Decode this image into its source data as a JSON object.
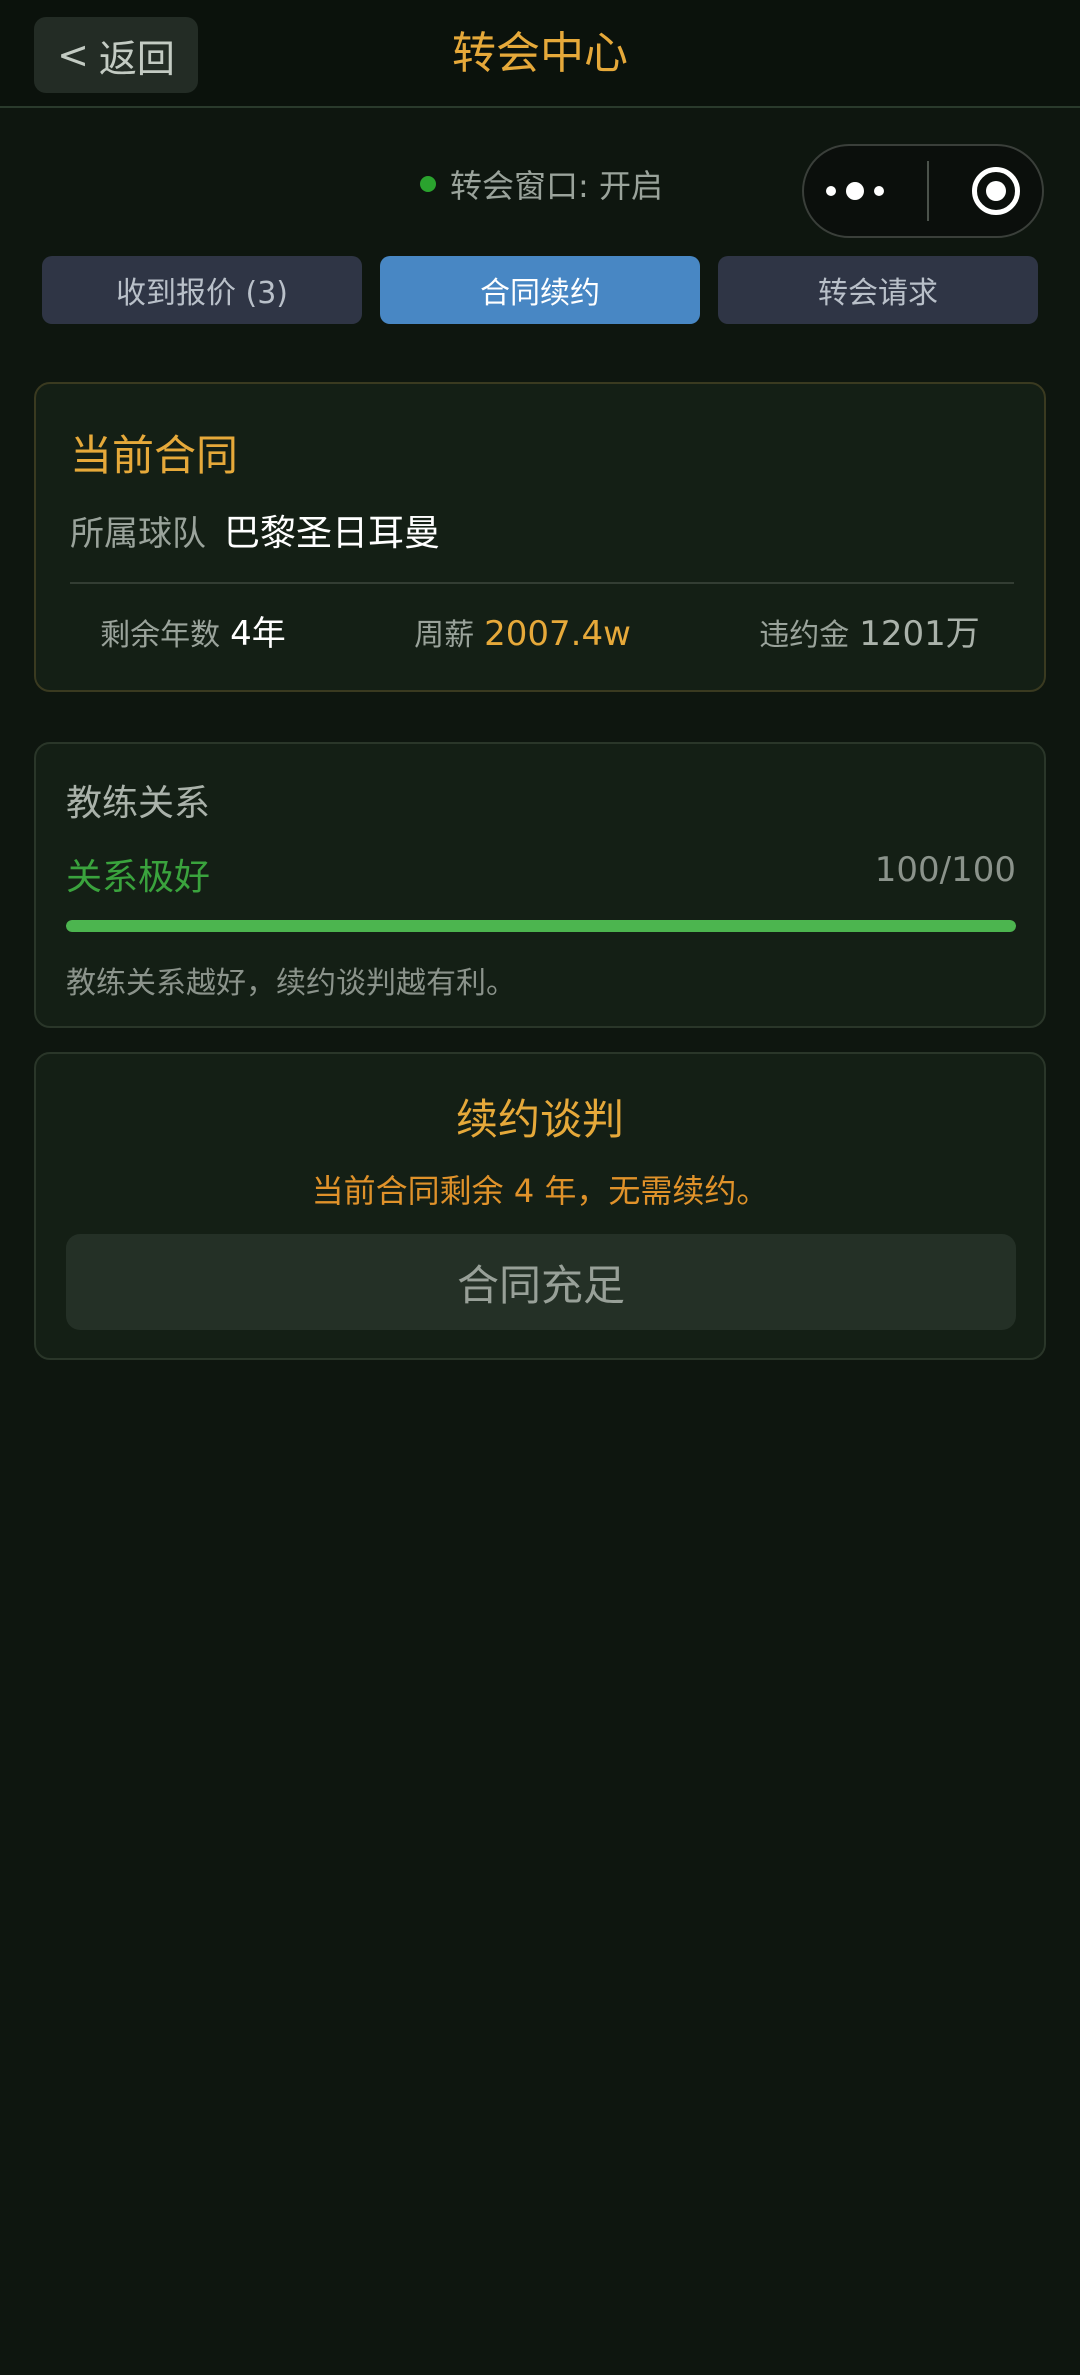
{
  "header": {
    "back_label": "返回",
    "back_chevron": "<",
    "title": "转会中心"
  },
  "status": {
    "text": "转会窗口: 开启",
    "dot_color": "#2aa32e"
  },
  "capsule": {
    "more_icon": "more-dots-icon",
    "close_icon": "target-circle-icon"
  },
  "tabs": [
    {
      "label": "收到报价 (3)",
      "active": false
    },
    {
      "label": "合同续约",
      "active": true
    },
    {
      "label": "转会请求",
      "active": false
    }
  ],
  "contract": {
    "title": "当前合同",
    "team_label": "所属球队",
    "team_name": "巴黎圣日耳曼",
    "stats": [
      {
        "label": "剩余年数",
        "value": "4年"
      },
      {
        "label": "周薪",
        "value": "2007.4w"
      },
      {
        "label": "违约金",
        "value": "1201万"
      }
    ]
  },
  "coach": {
    "title": "教练关系",
    "status": "关系极好",
    "score": "100/100",
    "level_percent": 100,
    "hint": "教练关系越好，续约谈判越有利。"
  },
  "renewal": {
    "title": "续约谈判",
    "message": "当前合同剩余 4 年，无需续约。",
    "button_label": "合同充足"
  },
  "colors": {
    "accent_gold": "#e6a93a",
    "tab_active": "#4887c4",
    "good_green": "#4cb54f"
  }
}
